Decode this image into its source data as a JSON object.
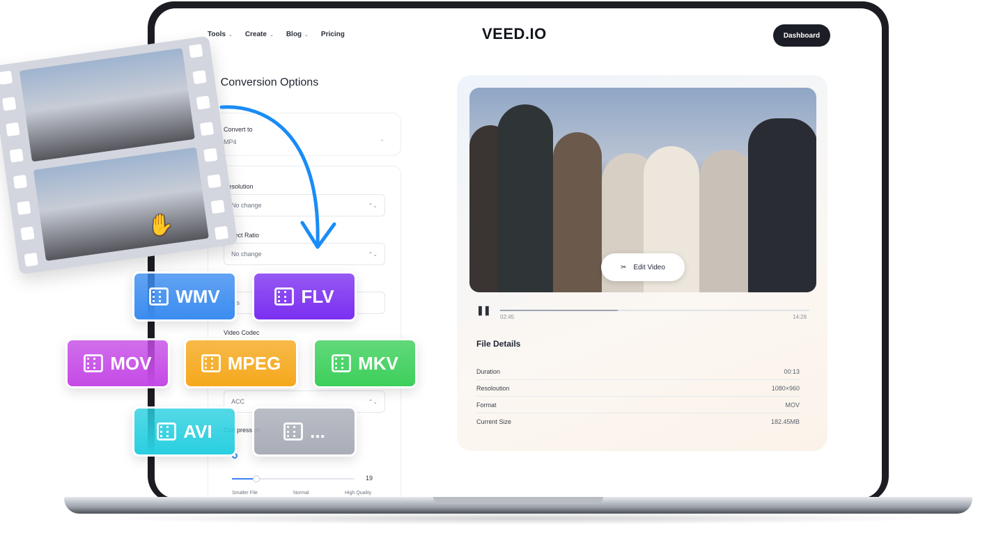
{
  "nav": {
    "items": [
      {
        "label": "Tools",
        "has_dropdown": true
      },
      {
        "label": "Create",
        "has_dropdown": true
      },
      {
        "label": "Blog",
        "has_dropdown": true
      },
      {
        "label": "Pricing",
        "has_dropdown": false
      }
    ],
    "logo": "VEED.IO",
    "dashboard_label": "Dashboard"
  },
  "conversion": {
    "back_icon": "chevron-left-icon",
    "title": "Conversion Options",
    "convert_to": {
      "label": "Convert to",
      "value": "MP4"
    },
    "resolution": {
      "label": "Resolution",
      "value": "No change"
    },
    "aspect_ratio": {
      "label": "Aspect Ratio",
      "value": "No change"
    },
    "frame_rate": {
      "value": "fps"
    },
    "video_codec": {
      "label": "Video Codec"
    },
    "audio_codec": {
      "value": "ACC"
    },
    "compression": {
      "label": "Compression",
      "slider_value": "19",
      "slider_fraction": 0.2,
      "scale_labels": [
        "Smaller File",
        "Normal",
        "High Quality"
      ]
    }
  },
  "player": {
    "edit_label": "Edit Video",
    "edit_icon": "scissors-icon",
    "pause_icon": "pause-icon",
    "current_time": "02:45",
    "total_time": "14:28",
    "progress_fraction": 0.38
  },
  "file_details": {
    "title": "File Details",
    "rows": [
      {
        "label": "Duration",
        "value": "00:13"
      },
      {
        "label": "Resoloution",
        "value": "1080×960"
      },
      {
        "label": "Format",
        "value": "MOV"
      },
      {
        "label": "Current Size",
        "value": "182.45MB"
      }
    ]
  },
  "formats": [
    {
      "label": "WMV",
      "color": "#3b8cf0"
    },
    {
      "label": "FLV",
      "color": "#7b2ff0"
    },
    {
      "label": "MOV",
      "color": "#c54ae6"
    },
    {
      "label": "MPEG",
      "color": "#f5a81c"
    },
    {
      "label": "MKV",
      "color": "#3ccf5a"
    },
    {
      "label": "AVI",
      "color": "#29cfe0"
    },
    {
      "label": "...",
      "color": "#a9adb7"
    }
  ],
  "colors": {
    "arrow": "#1a8cf5",
    "dashboard_bg": "#1b1e26"
  }
}
